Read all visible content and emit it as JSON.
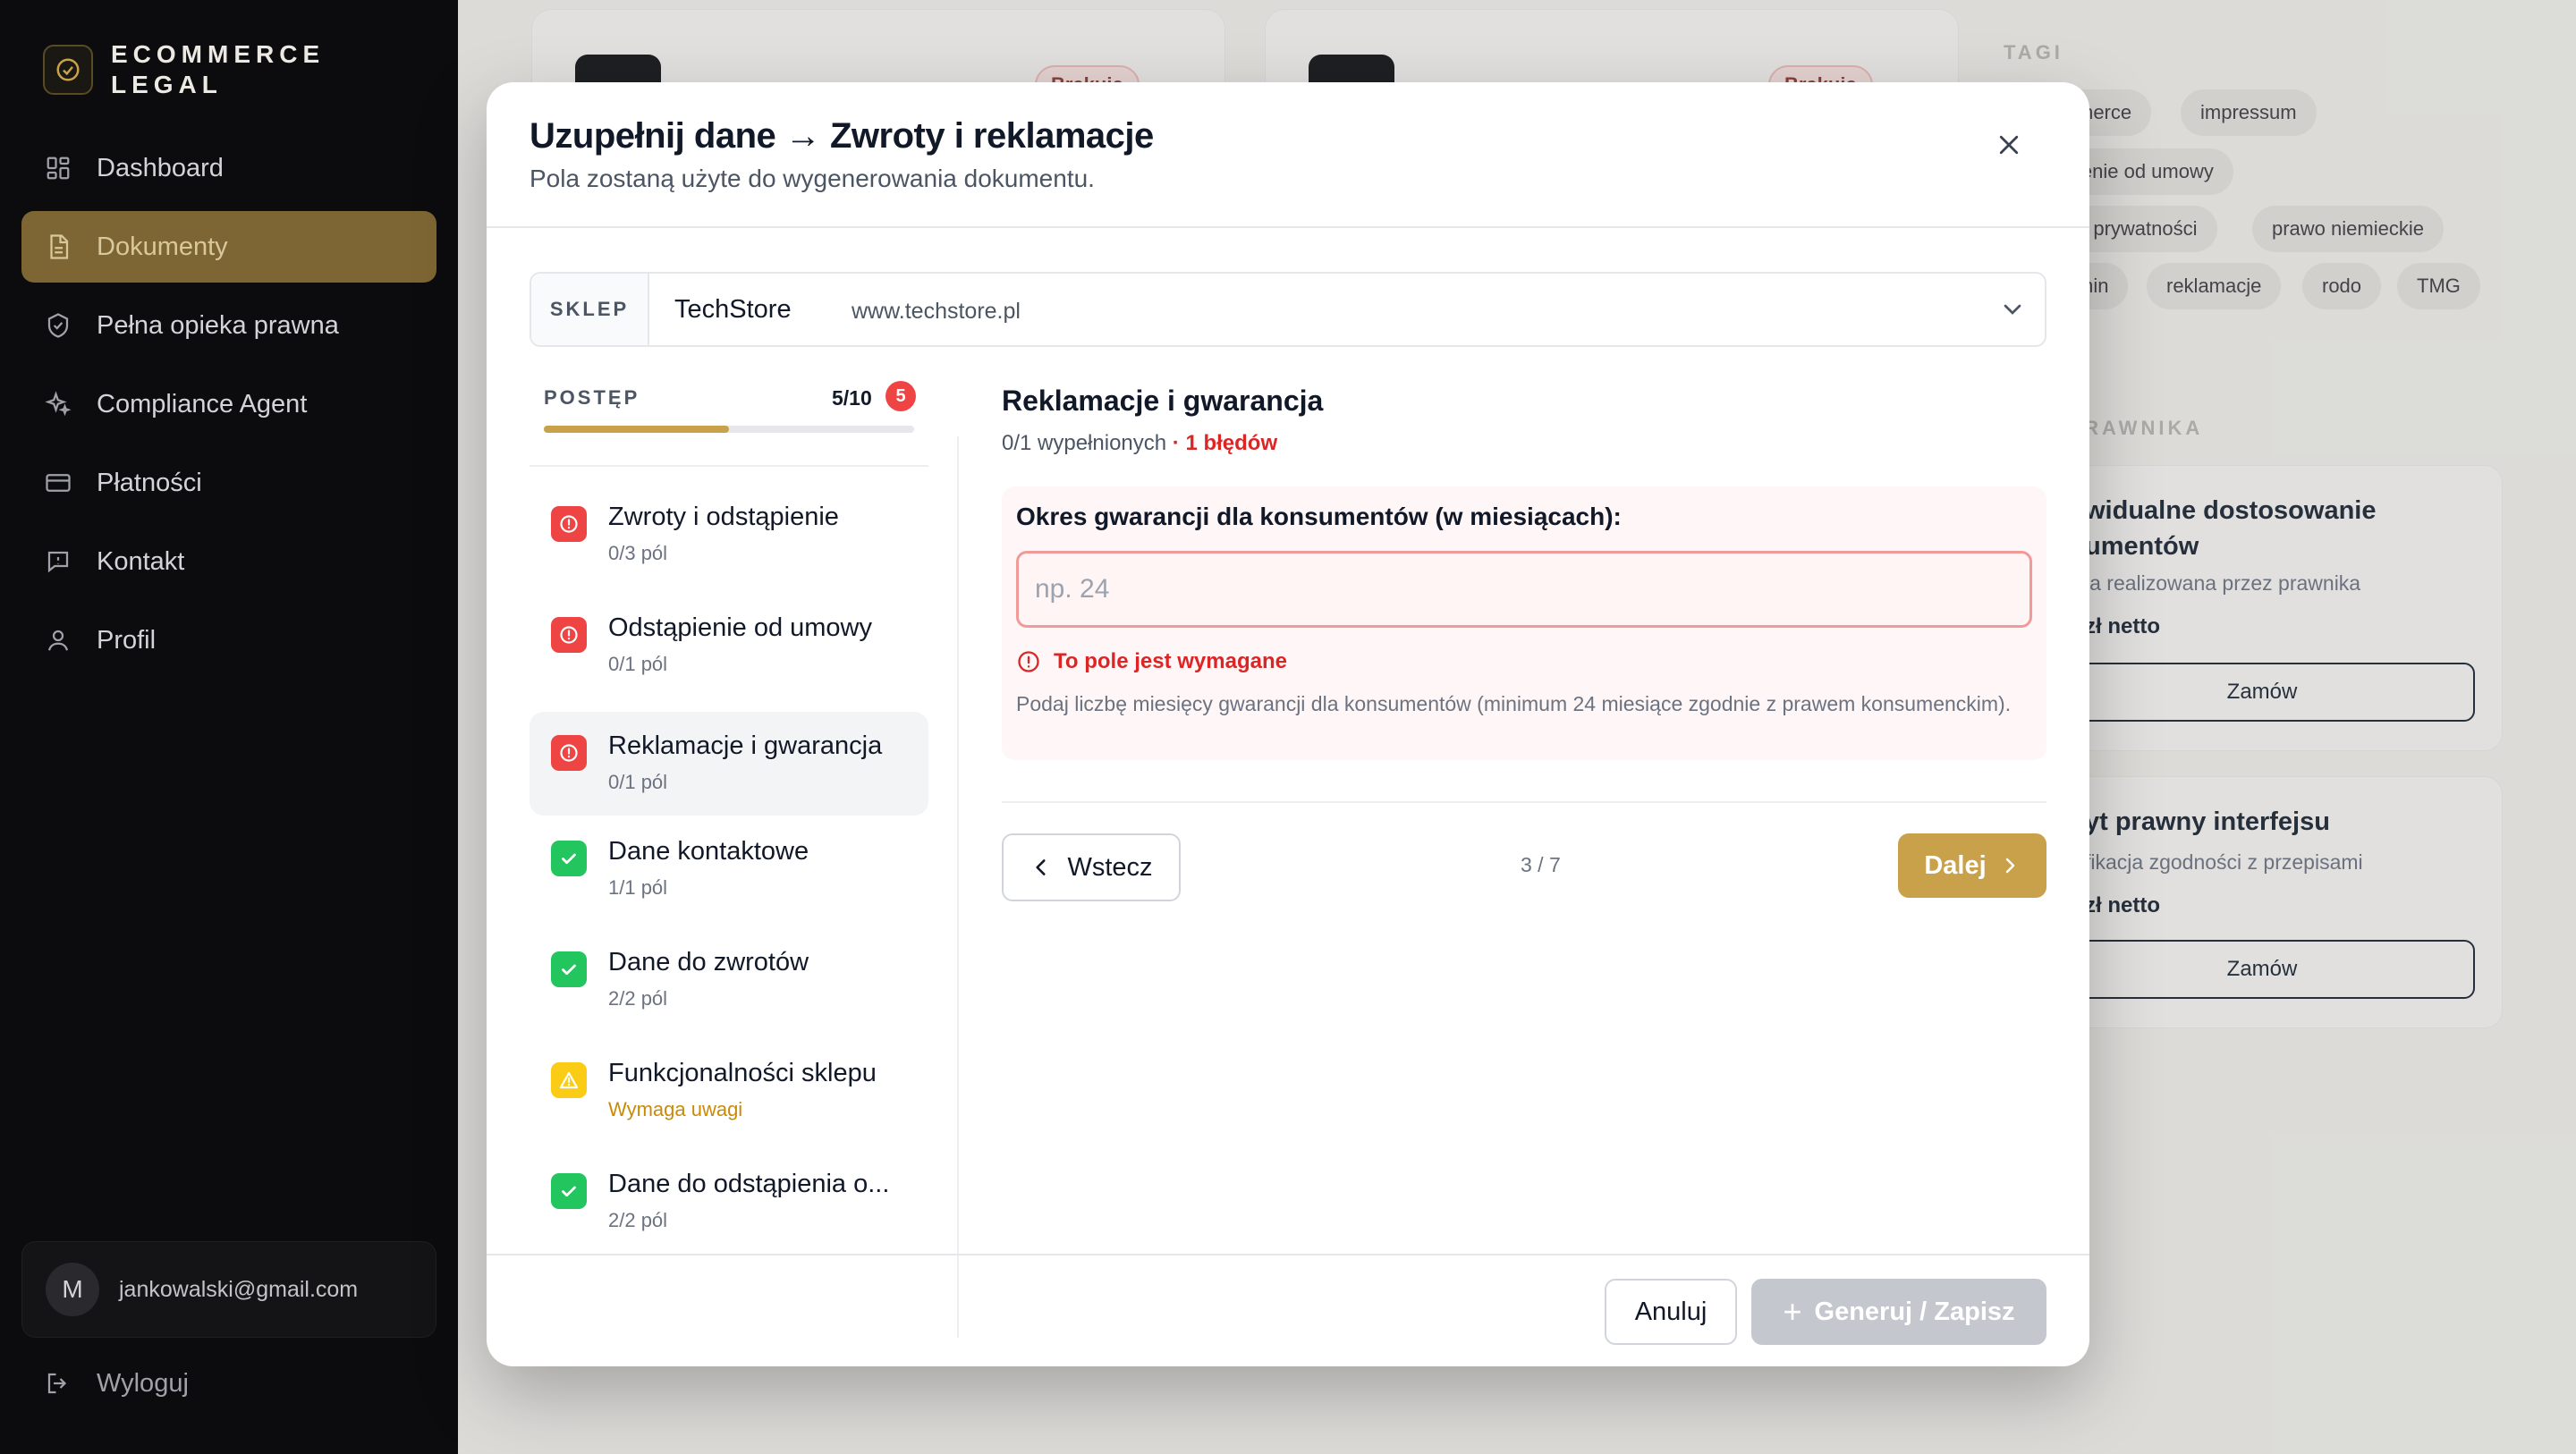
{
  "sidebar": {
    "brand_line1": "ECOMMERCE",
    "brand_line2": "LEGAL",
    "items": [
      {
        "label": "Dashboard",
        "icon": "grid-icon"
      },
      {
        "label": "Dokumenty",
        "icon": "document-icon",
        "active": true
      },
      {
        "label": "Pełna opieka prawna",
        "icon": "shield-icon"
      },
      {
        "label": "Compliance Agent",
        "icon": "sparkles-icon"
      },
      {
        "label": "Płatności",
        "icon": "credit-card-icon"
      },
      {
        "label": "Kontakt",
        "icon": "chat-icon"
      },
      {
        "label": "Profil",
        "icon": "user-icon"
      }
    ],
    "user": {
      "initial": "M",
      "email": "jankowalski@gmail.com"
    },
    "logout_label": "Wyloguj"
  },
  "background": {
    "badge_label": "Brakuje",
    "tags_title": "TAGI",
    "tags": [
      "merce",
      "impressum",
      "ienie od umowy",
      "a prywatności",
      "prawo niemieckie",
      "min",
      "reklamacje",
      "rodo",
      "TMG"
    ],
    "section_title": ": PRAWNIKA",
    "services": [
      {
        "title_l1": "widualne dostosowanie",
        "title_l2": "umentów",
        "sub": "ja realizowana przez prawnika",
        "price": "zł netto",
        "button": "Zamów"
      },
      {
        "title_l1": "yt prawny interfejsu",
        "title_l2": "",
        "sub": "fikacja zgodności z przepisami",
        "price": "zł netto",
        "button": "Zamów"
      }
    ]
  },
  "modal": {
    "title": "Uzupełnij dane → Zwroty i reklamacje",
    "subtitle": "Pola zostaną użyte do wygenerowania dokumentu.",
    "store": {
      "label": "SKLEP",
      "name": "TechStore",
      "url": "www.techstore.pl"
    },
    "progress": {
      "label": "POSTĘP",
      "count": "5/10",
      "errors": "5",
      "fraction": 0.5
    },
    "steps": [
      {
        "title": "Zwroty i odstąpienie",
        "sub": "0/3 pól",
        "status": "error"
      },
      {
        "title": "Odstąpienie od umowy",
        "sub": "0/1 pól",
        "status": "error"
      },
      {
        "title": "Reklamacje i gwarancja",
        "sub": "0/1 pól",
        "status": "error",
        "active": true
      },
      {
        "title": "Dane kontaktowe",
        "sub": "1/1 pól",
        "status": "ok"
      },
      {
        "title": "Dane do zwrotów",
        "sub": "2/2 pól",
        "status": "ok"
      },
      {
        "title": "Funkcjonalności sklepu",
        "sub": "Wymaga uwagi",
        "status": "warn"
      },
      {
        "title": "Dane do odstąpienia o...",
        "sub": "2/2 pól",
        "status": "ok"
      }
    ],
    "section": {
      "title": "Reklamacje i gwarancja",
      "filled": "0/1 wypełnionych",
      "errors": "· 1 błędów"
    },
    "field": {
      "label": "Okres gwarancji dla konsumentów (w miesiącach):",
      "placeholder": "np. 24",
      "value": "",
      "error": "To pole jest wymagane",
      "help": "Podaj liczbę miesięcy gwarancji dla konsumentów (minimum 24 miesiące zgodnie z prawem konsumenckim)."
    },
    "nav": {
      "back": "Wstecz",
      "page": "3 / 7",
      "next": "Dalej"
    },
    "footer": {
      "cancel": "Anuluj",
      "generate": "Generuj / Zapisz"
    }
  },
  "colors": {
    "accent": "#c9a14a",
    "error": "#ef4444",
    "success": "#22c55e",
    "warning": "#facc15",
    "sidebar_bg": "#0c0c0e"
  }
}
